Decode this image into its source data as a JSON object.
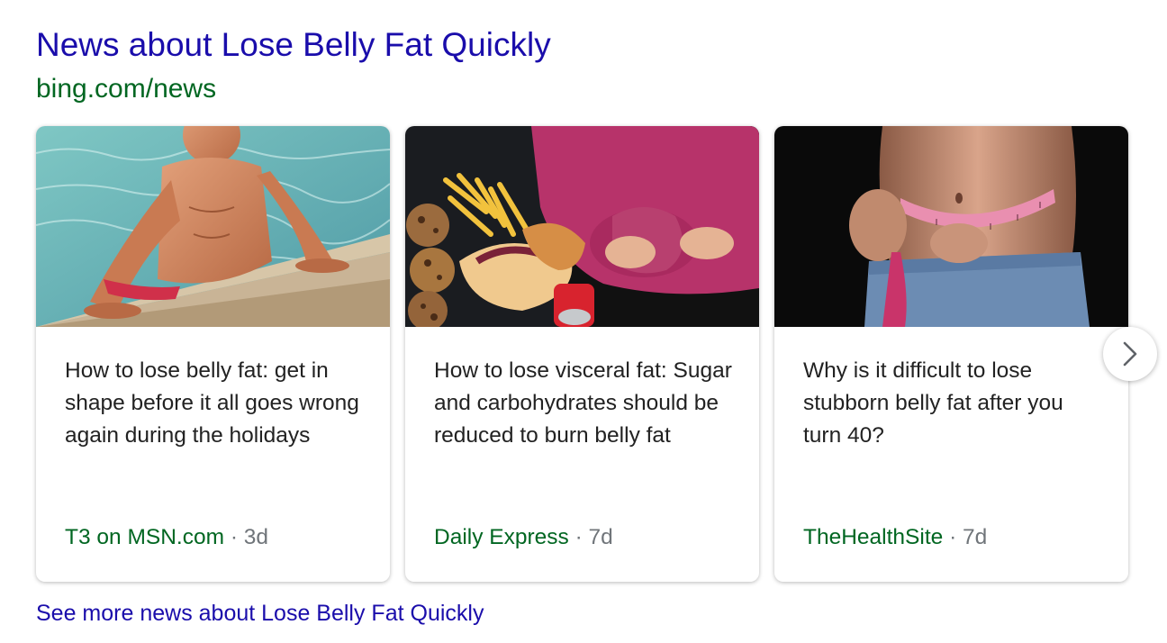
{
  "header": {
    "title": "News about Lose Belly Fat Quickly",
    "source_url": "bing.com/news"
  },
  "cards": [
    {
      "image": "man-in-pool-photo",
      "headline": "How to lose belly fat: get in shape before it all goes wrong again during the holidays",
      "source": "T3 on MSN.com",
      "separator": "·",
      "age": "3d"
    },
    {
      "image": "junk-food-and-belly-photo",
      "headline": "How to lose visceral fat: Sugar and carbohydrates should be reduced to burn belly fat",
      "source": "Daily Express",
      "separator": "·",
      "age": "7d"
    },
    {
      "image": "measuring-tape-waist-photo",
      "headline": "Why is it difficult to lose stubborn belly fat after you turn 40?",
      "source": "TheHealthSite",
      "separator": "·",
      "age": "7d"
    }
  ],
  "carousel": {
    "next_icon": "chevron-right-icon"
  },
  "footer": {
    "more_link": "See more news about Lose Belly Fat Quickly"
  },
  "colors": {
    "link": "#1a0dab",
    "source_green": "#006621",
    "muted": "#70757a",
    "text": "#222222"
  }
}
